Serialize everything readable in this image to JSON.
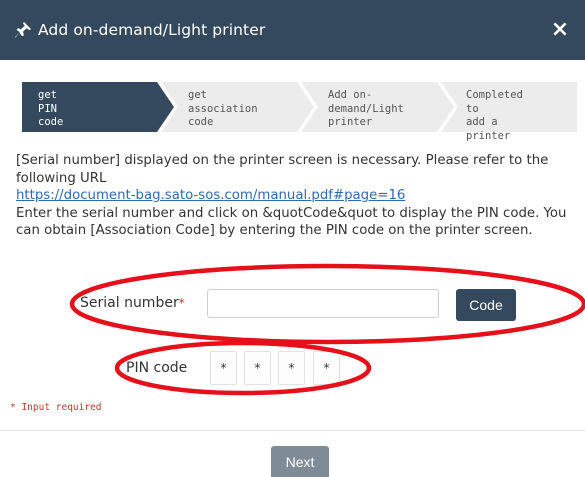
{
  "dialog": {
    "title": "Add on-demand/Light printer",
    "close_icon": "close-icon",
    "header_icon": "pin-icon",
    "close_glyph": "×"
  },
  "steps": [
    {
      "label": "get PIN code",
      "active": true
    },
    {
      "label": "get association\ncode",
      "active": false
    },
    {
      "label": "Add on-\ndemand/Light\nprinter",
      "active": false
    },
    {
      "label": "Completed to\nadd a printer",
      "active": false
    }
  ],
  "description": {
    "line1": "[Serial number] displayed on the printer screen is necessary. Please refer to the following URL",
    "url": "https://document-bag.sato-sos.com/manual.pdf#page=16",
    "line2": "Enter the serial number and click on &quotCode&quot to display the PIN code. You can obtain [Association Code] by entering the PIN code on the printer screen."
  },
  "form": {
    "serial_label": "Serial number",
    "required_star": "*",
    "serial_value": "",
    "code_button": "Code",
    "pin_label": "PIN code",
    "pin_digits": [
      "*",
      "*",
      "*",
      "*"
    ],
    "required_note": "* Input required"
  },
  "footer": {
    "next_button": "Next"
  },
  "colors": {
    "header_bg": "#34495e",
    "active_step": "#34495e",
    "inactive_step": "#ececec",
    "annotation": "#e5101a",
    "required": "#c0392b",
    "next_bg": "#7f8c98"
  }
}
